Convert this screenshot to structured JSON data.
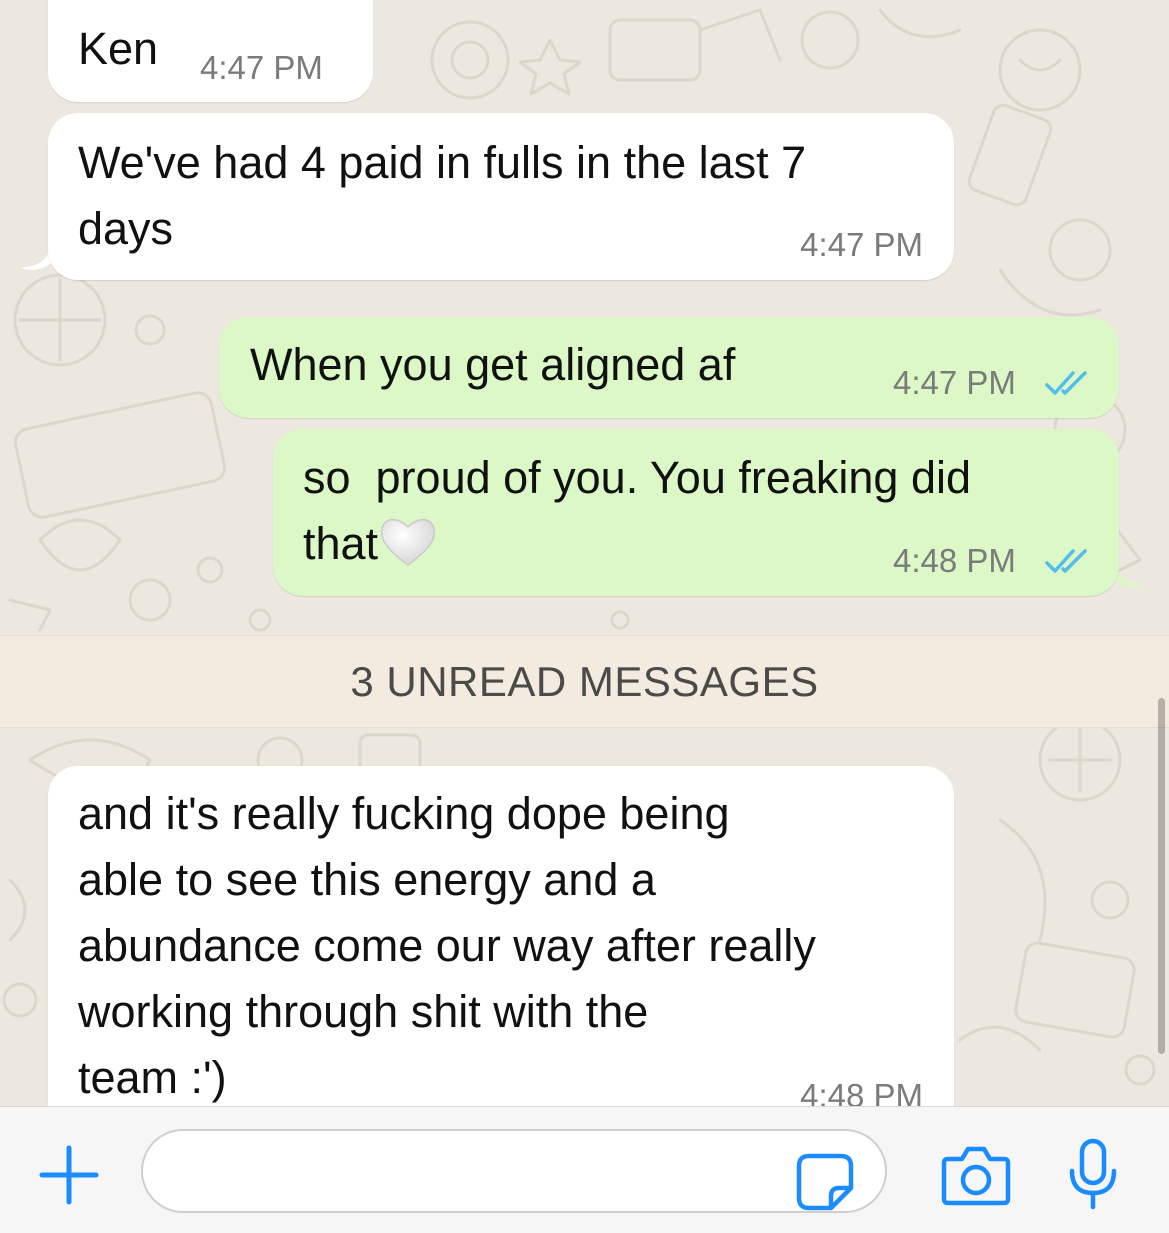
{
  "messages": [
    {
      "direction": "incoming",
      "text": "Ken",
      "time": "4:47 PM"
    },
    {
      "direction": "incoming",
      "text": "We've had 4 paid in fulls in the last 7\ndays",
      "time": "4:47 PM"
    },
    {
      "direction": "outgoing",
      "text": "When you get aligned af",
      "time": "4:47 PM",
      "status": "read"
    },
    {
      "direction": "outgoing",
      "text": "so  proud of you. You freaking did\nthat",
      "emoji": "white-heart",
      "time": "4:48 PM",
      "status": "read"
    },
    {
      "direction": "incoming",
      "text": "and it's really fucking dope being\nable to see this energy and a\nabundance come our way after really\nworking through shit with the\nteam :')",
      "time": "4:48 PM"
    }
  ],
  "unread_banner": "3 UNREAD MESSAGES",
  "composer": {
    "placeholder": "",
    "value": ""
  },
  "icons": [
    "plus-icon",
    "sticker-icon",
    "camera-icon",
    "microphone-icon",
    "double-check-icon",
    "white-heart-emoji"
  ],
  "colors": {
    "accent": "#1a8cff",
    "read_ticks": "#53bdeb",
    "outgoing_bubble": "#dcf8c6",
    "incoming_bubble": "#ffffff",
    "chat_background": "#ece7df",
    "unread_banner": "#f3ebe0"
  }
}
